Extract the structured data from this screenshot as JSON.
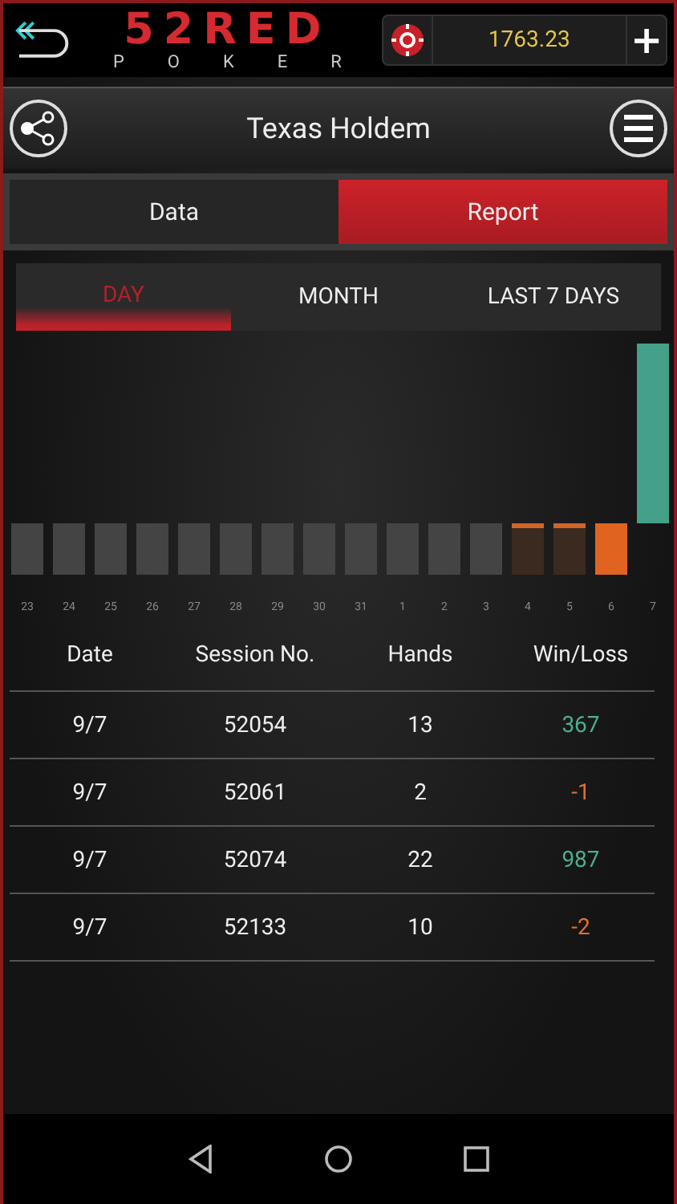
{
  "header": {
    "logo_top": "52RED",
    "logo_bottom": "POKER",
    "balance": "1763.23",
    "add_button": "+"
  },
  "title_bar": {
    "title": "Texas Holdem"
  },
  "view_tabs": [
    {
      "label": "Data",
      "selected": false
    },
    {
      "label": "Report",
      "selected": true
    }
  ],
  "period_tabs": [
    {
      "label": "DAY",
      "selected": true
    },
    {
      "label": "MONTH",
      "selected": false
    },
    {
      "label": "LAST 7 DAYS",
      "selected": false
    }
  ],
  "days": [
    {
      "label": "23",
      "kind": "empty"
    },
    {
      "label": "24",
      "kind": "empty"
    },
    {
      "label": "25",
      "kind": "empty"
    },
    {
      "label": "26",
      "kind": "empty"
    },
    {
      "label": "27",
      "kind": "empty"
    },
    {
      "label": "28",
      "kind": "empty"
    },
    {
      "label": "29",
      "kind": "empty"
    },
    {
      "label": "30",
      "kind": "empty"
    },
    {
      "label": "31",
      "kind": "empty"
    },
    {
      "label": "1",
      "kind": "empty"
    },
    {
      "label": "2",
      "kind": "empty"
    },
    {
      "label": "3",
      "kind": "empty"
    },
    {
      "label": "4",
      "kind": "small-loss"
    },
    {
      "label": "5",
      "kind": "small-loss"
    },
    {
      "label": "6",
      "kind": "loss"
    },
    {
      "label": "7",
      "kind": "win"
    }
  ],
  "table": {
    "columns": [
      "Date",
      "Session No.",
      "Hands",
      "Win/Loss"
    ],
    "rows": [
      {
        "cells": [
          "9/7",
          "52054",
          "13",
          "367"
        ],
        "color": "#4caf8f"
      },
      {
        "cells": [
          "9/7",
          "52061",
          "2",
          "-1"
        ],
        "color": "#e07030"
      },
      {
        "cells": [
          "9/7",
          "52074",
          "22",
          "987"
        ],
        "color": "#4caf8f"
      },
      {
        "cells": [
          "9/7",
          "52133",
          "10",
          "-2"
        ],
        "color": "#e07030"
      }
    ]
  }
}
